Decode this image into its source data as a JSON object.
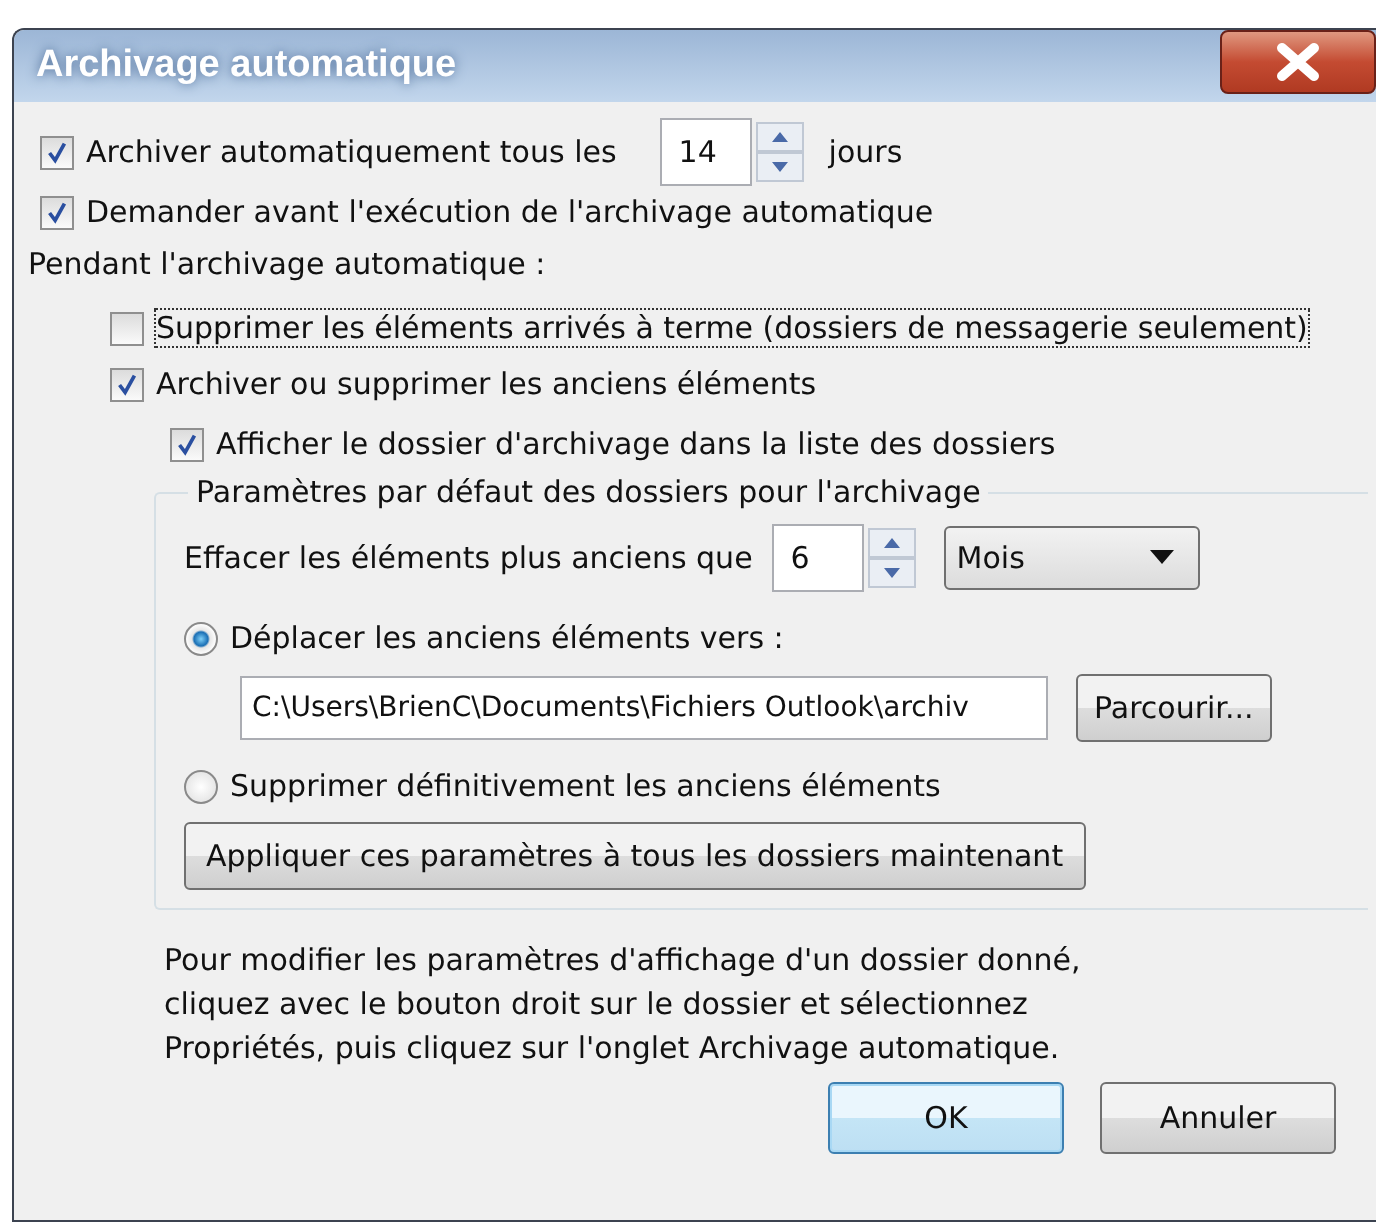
{
  "window": {
    "title": "Archivage automatique"
  },
  "auto_archive": {
    "label": "Archiver automatiquement tous les",
    "checked": true,
    "value": "14",
    "unit": "jours"
  },
  "prompt": {
    "label": "Demander avant l'exécution de l'archivage automatique",
    "checked": true
  },
  "section_label": "Pendant l'archivage automatique :",
  "delete_expired": {
    "label": "Supprimer les éléments arrivés à terme (dossiers de messagerie seulement)",
    "checked": false,
    "focused": true
  },
  "archive_old": {
    "label": "Archiver ou supprimer les anciens éléments",
    "checked": true
  },
  "show_folder": {
    "label": "Afficher le dossier d'archivage dans la liste des dossiers",
    "checked": true
  },
  "group": {
    "title": "Paramètres par défaut des dossiers pour l'archivage",
    "older_than": {
      "label": "Effacer les éléments plus anciens que",
      "value": "6",
      "unit": "Mois"
    },
    "options": [
      {
        "label": "Déplacer les anciens éléments vers :",
        "selected": true,
        "path": "C:\\Users\\BrienC\\Documents\\Fichiers Outlook\\archiv",
        "browse": "Parcourir..."
      },
      {
        "label": "Supprimer définitivement les anciens éléments",
        "selected": false
      }
    ],
    "apply": "Appliquer ces paramètres à tous les dossiers maintenant"
  },
  "note": "Pour modifier les paramètres d'affichage d'un dossier donné,\ncliquez avec le bouton droit sur le dossier et sélectionnez\nPropriétés, puis cliquez sur l'onglet Archivage automatique.",
  "buttons": [
    {
      "label": "OK",
      "default": true
    },
    {
      "label": "Annuler",
      "default": false
    }
  ]
}
